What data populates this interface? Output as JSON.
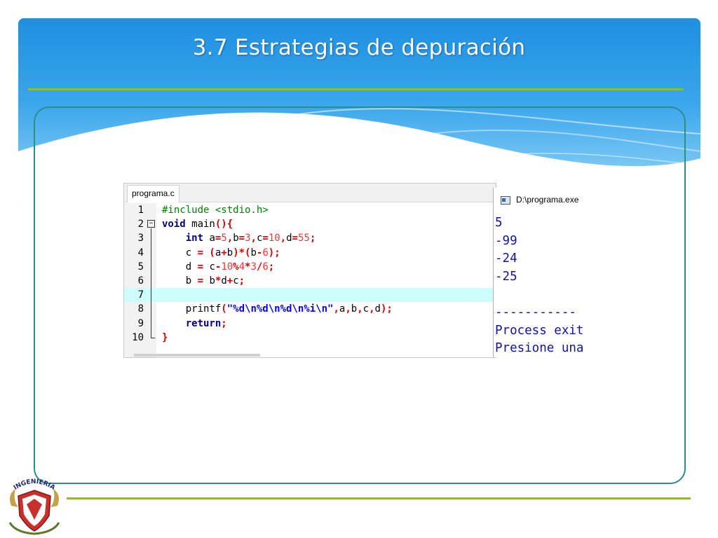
{
  "slide": {
    "title": "3.7  Estrategias de depuración",
    "colors": {
      "banner": "#2a9be6",
      "rule": "#8dbb34",
      "frame": "#2c8d8a"
    },
    "logo_icon": "unam-ingenieria-crest-icon",
    "logo_text": "INGENIERIA"
  },
  "editor": {
    "tab_label": "programa.c",
    "lines": [
      {
        "num": "1",
        "tokens": [
          [
            "pp",
            "#include <stdio.h>"
          ]
        ]
      },
      {
        "num": "2",
        "tokens": [
          [
            "kw",
            "void"
          ],
          [
            "plain",
            " main"
          ],
          [
            "op",
            "(){"
          ]
        ]
      },
      {
        "num": "3",
        "tokens": [
          [
            "plain",
            "    "
          ],
          [
            "kw",
            "int"
          ],
          [
            "plain",
            " a"
          ],
          [
            "op",
            "="
          ],
          [
            "num",
            "5"
          ],
          [
            "op",
            ","
          ],
          [
            "plain",
            "b"
          ],
          [
            "op",
            "="
          ],
          [
            "num",
            "3"
          ],
          [
            "op",
            ","
          ],
          [
            "plain",
            "c"
          ],
          [
            "op",
            "="
          ],
          [
            "num",
            "10"
          ],
          [
            "op",
            ","
          ],
          [
            "plain",
            "d"
          ],
          [
            "op",
            "="
          ],
          [
            "num",
            "55"
          ],
          [
            "op",
            ";"
          ]
        ]
      },
      {
        "num": "4",
        "tokens": [
          [
            "plain",
            "    c "
          ],
          [
            "op",
            "= ("
          ],
          [
            "plain",
            "a"
          ],
          [
            "op",
            "+"
          ],
          [
            "plain",
            "b"
          ],
          [
            "op",
            ")*("
          ],
          [
            "plain",
            "b"
          ],
          [
            "op",
            "-"
          ],
          [
            "num",
            "6"
          ],
          [
            "op",
            ");"
          ]
        ]
      },
      {
        "num": "5",
        "tokens": [
          [
            "plain",
            "    d "
          ],
          [
            "op",
            "="
          ],
          [
            "plain",
            " c"
          ],
          [
            "op",
            "-"
          ],
          [
            "num",
            "10"
          ],
          [
            "op",
            "%"
          ],
          [
            "num",
            "4"
          ],
          [
            "op",
            "*"
          ],
          [
            "num",
            "3"
          ],
          [
            "op",
            "/"
          ],
          [
            "num",
            "6"
          ],
          [
            "op",
            ";"
          ]
        ]
      },
      {
        "num": "6",
        "tokens": [
          [
            "plain",
            "    b "
          ],
          [
            "op",
            "="
          ],
          [
            "plain",
            " b"
          ],
          [
            "op",
            "*"
          ],
          [
            "plain",
            "d"
          ],
          [
            "op",
            "+"
          ],
          [
            "plain",
            "c"
          ],
          [
            "op",
            ";"
          ]
        ]
      },
      {
        "num": "7",
        "tokens": [
          [
            "plain",
            ""
          ]
        ]
      },
      {
        "num": "8",
        "tokens": [
          [
            "plain",
            "    printf"
          ],
          [
            "op",
            "("
          ],
          [
            "str",
            "\"%d\\n%d\\n%d\\n%i\\n\""
          ],
          [
            "op",
            ","
          ],
          [
            "plain",
            "a"
          ],
          [
            "op",
            ","
          ],
          [
            "plain",
            "b"
          ],
          [
            "op",
            ","
          ],
          [
            "plain",
            "c"
          ],
          [
            "op",
            ","
          ],
          [
            "plain",
            "d"
          ],
          [
            "op",
            ");"
          ]
        ]
      },
      {
        "num": "9",
        "tokens": [
          [
            "plain",
            "    "
          ],
          [
            "kw",
            "return"
          ],
          [
            "op",
            ";"
          ]
        ]
      },
      {
        "num": "10",
        "tokens": [
          [
            "op",
            "}"
          ]
        ]
      }
    ],
    "fold_marker": "−"
  },
  "console": {
    "title": "D:\\programa.exe",
    "icon": "console-window-icon",
    "output_lines": [
      "5",
      "-99",
      "-24",
      "-25",
      "",
      "-----------",
      "Process exit",
      "Presione una"
    ]
  }
}
